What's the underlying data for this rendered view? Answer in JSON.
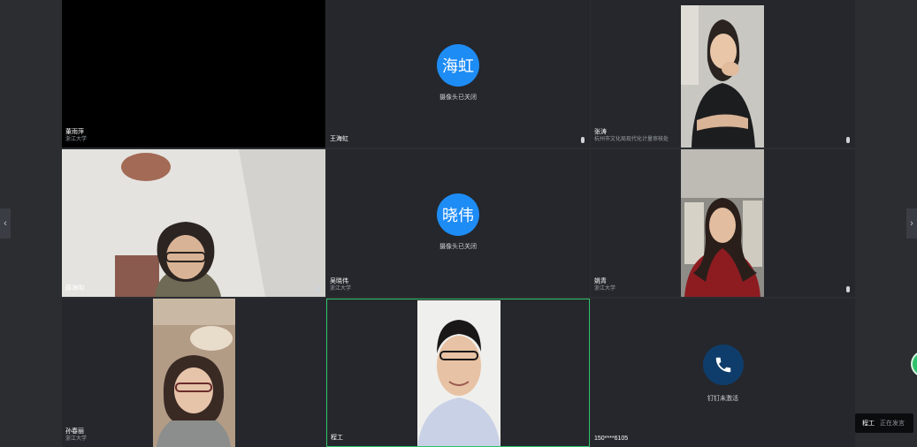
{
  "tiles": [
    {
      "name": "董雨萍",
      "org": "浙江大学"
    },
    {
      "name": "王海虹",
      "avatar": "海虹",
      "status": "摄像头已关闭"
    },
    {
      "name": "张涛",
      "org": "杭州市文化局现代化计量审核处"
    },
    {
      "name": "薛海明"
    },
    {
      "name": "吴晓伟",
      "org": "浙江大学",
      "avatar": "晓伟",
      "status": "摄像头已关闭"
    },
    {
      "name": "姚青",
      "org": "浙江大学"
    },
    {
      "name": "孙春丽",
      "org": "浙江大学"
    },
    {
      "name": "程工"
    },
    {
      "name": "150****6105",
      "status": "钉钉未激活"
    }
  ],
  "speaking": {
    "who": "程工",
    "status": "正在发言"
  },
  "icons": {
    "phone": "phone-icon",
    "left": "chevron-left-icon",
    "right": "chevron-right-icon",
    "mic": "microphone-icon"
  },
  "colors": {
    "avatar": "#1e8cf5",
    "active_border": "#2ec26a",
    "phone_bg": "#0f3d6b"
  }
}
